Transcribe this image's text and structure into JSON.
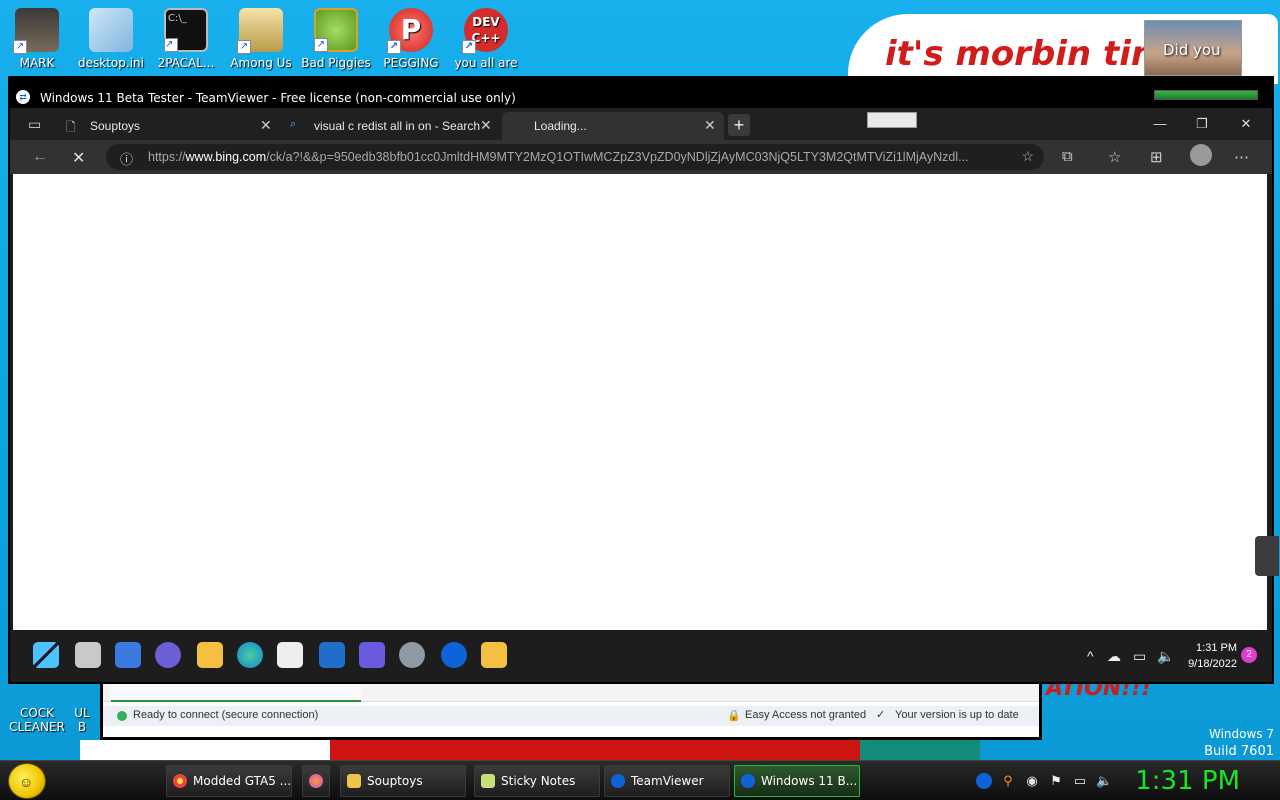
{
  "desktop": {
    "icons": [
      {
        "label": "MARK",
        "icon": "mark-doll-icon",
        "color": "#5a4a3a"
      },
      {
        "label": "desktop.ini",
        "icon": "ini-file-icon",
        "color": "#8fc3e8"
      },
      {
        "label": "2PACAL...",
        "icon": "cmd-icon",
        "color": "#111111"
      },
      {
        "label": "Among Us",
        "icon": "among-us-icon",
        "color": "#e8c978"
      },
      {
        "label": "Bad Piggies",
        "icon": "bad-piggies-icon",
        "color": "#7fc241"
      },
      {
        "label": "PEGGING",
        "icon": "pegging-icon",
        "color": "#e53d3d"
      },
      {
        "label": "you all are",
        "icon": "devcpp-icon",
        "color": "#d42c2c"
      }
    ],
    "left_icons": [
      {
        "label": "COCK CLEANER",
        "icon": "ccleaner-icon"
      },
      {
        "label": "UL B",
        "icon": "partial-icon"
      }
    ],
    "meme_text": "it's morbin tim",
    "meme_caption": "Did you",
    "meme_bottom_text": "ATION!!!",
    "windows_version": "Windows 7",
    "build": "Build 7601"
  },
  "teamviewer_panel": {
    "status_ready": "Ready to connect (secure connection)",
    "easy_access": "Easy Access not granted",
    "version": "Your version is up to date"
  },
  "remote": {
    "title": "Windows 11 Beta Tester - TeamViewer - Free license (non-commercial use only)",
    "browser": {
      "tabs": [
        {
          "label": "Souptoys",
          "icon": "page-icon"
        },
        {
          "label": "visual c redist all in on - Search",
          "icon": "search-icon"
        },
        {
          "label": "Loading...",
          "icon": ""
        }
      ],
      "new_tab": "+",
      "url_domain": "www.bing.com",
      "url_prefix": "https://",
      "url_rest": "/ck/a?!&&p=950edb38bfb01cc0JmltdHM9MTY2MzQ1OTIwMCZpZ3VpZD0yNDljZjAyMC03NjQ5LTY3M2QtMTViZi1lMjAyNzdl..."
    },
    "taskbar": {
      "time": "1:31 PM",
      "date": "9/18/2022",
      "notifications": "2"
    }
  },
  "host_taskbar": {
    "items": [
      {
        "label": "Modded GTA5 ...",
        "icon": "chrome-icon",
        "color": "#e8473a"
      },
      {
        "label": "Souptoys",
        "icon": "souptoys-icon",
        "color": "#f0c14b"
      },
      {
        "label": "Sticky Notes",
        "icon": "sticky-notes-icon",
        "color": "#c8e07a"
      },
      {
        "label": "TeamViewer",
        "icon": "teamviewer-icon",
        "color": "#0e63d8"
      },
      {
        "label": "Windows 11 B...",
        "icon": "teamviewer-icon",
        "color": "#0e63d8"
      }
    ],
    "clock": "1:31 PM"
  }
}
